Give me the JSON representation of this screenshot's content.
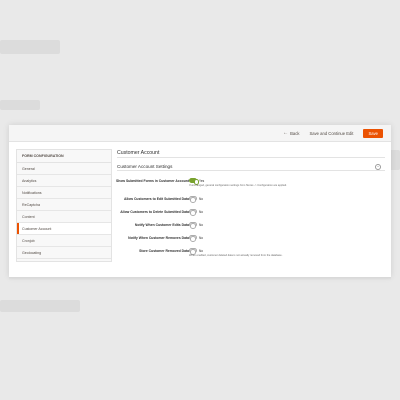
{
  "toolbar": {
    "back_label": "Back",
    "save_continue_label": "Save and Continue Edit",
    "save_label": "Save"
  },
  "sidebar": {
    "title": "FORM CONFIGURATION",
    "items": [
      {
        "label": "General",
        "active": false
      },
      {
        "label": "Analytics",
        "active": false
      },
      {
        "label": "Notifications",
        "active": false
      },
      {
        "label": "ReCaptcha",
        "active": false
      },
      {
        "label": "Content",
        "active": false
      },
      {
        "label": "Customer Account",
        "active": true
      },
      {
        "label": "Cronjob",
        "active": false
      },
      {
        "label": "Geolocating",
        "active": false
      }
    ]
  },
  "main": {
    "title": "Customer Account",
    "section_title": "Customer Account Settings",
    "fields": [
      {
        "label": "Show Submitted Forms in Customer Account",
        "toggle_text": "Yes",
        "on": true,
        "note": "If unchanged, general configuration settings from Stores -> Configuration are applied."
      },
      {
        "label": "Allow Customers to Edit Submitted Data",
        "toggle_text": "No",
        "on": false,
        "note": ""
      },
      {
        "label": "Allow Customers to Delete Submitted Data",
        "toggle_text": "No",
        "on": false,
        "note": ""
      },
      {
        "label": "Notify When Customer Edits Data",
        "toggle_text": "No",
        "on": false,
        "note": ""
      },
      {
        "label": "Notify When Customer Removes Data",
        "toggle_text": "No",
        "on": false,
        "note": ""
      },
      {
        "label": "Store Customer Removed Data",
        "toggle_text": "No",
        "on": false,
        "note": "When enabled, customer deleted data is not actually removed from the database."
      }
    ]
  },
  "colors": {
    "accent": "#eb5202",
    "toggle_on": "#79a22e"
  }
}
